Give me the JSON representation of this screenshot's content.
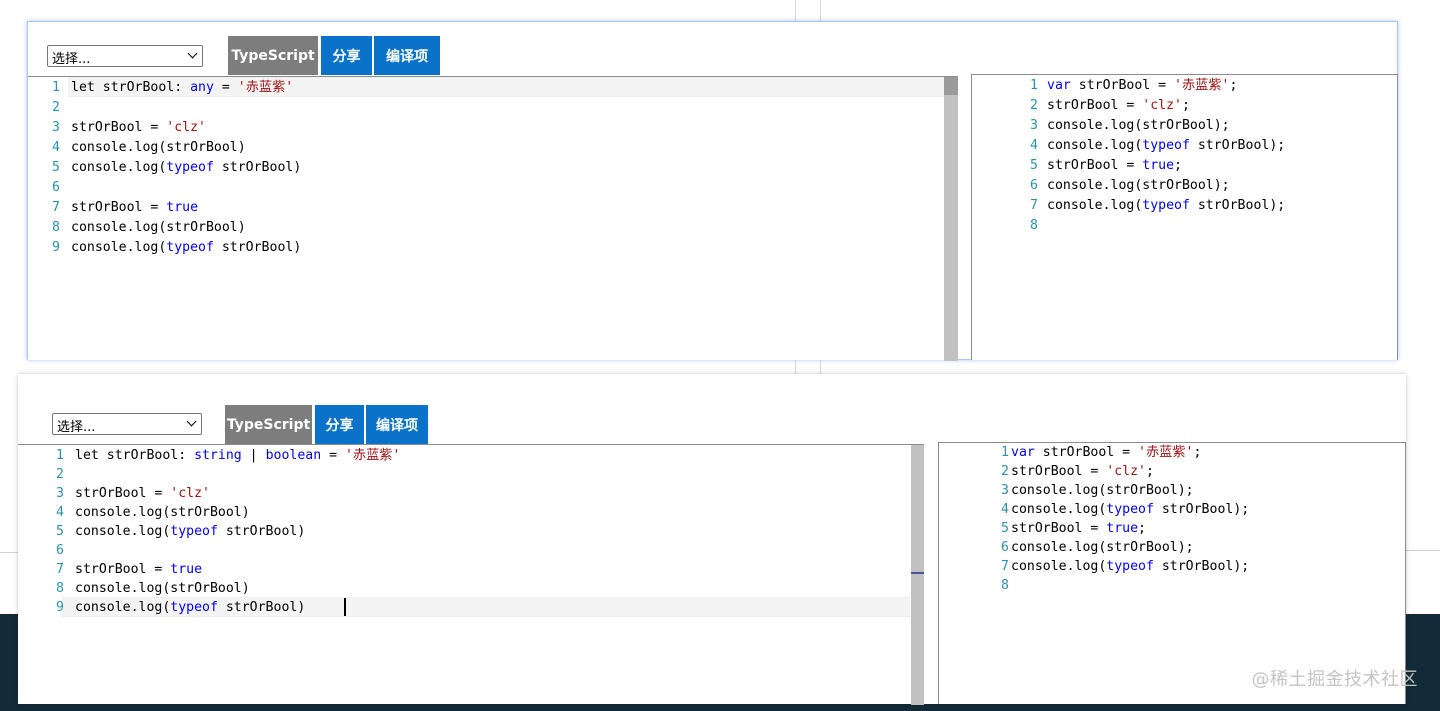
{
  "select_placeholder": "选择...",
  "buttons": {
    "typescript": "TypeScript",
    "share": "分享",
    "options": "编译项"
  },
  "watermark": "@稀土掘金技术社区",
  "colors": {
    "button_gray": "#7d7d7d",
    "button_blue": "#0a73c9",
    "keyword": "#0000ff",
    "string": "#a31515",
    "line_number": "#2b91af"
  },
  "top": {
    "input": [
      {
        "n": "1",
        "t": [
          {
            "c": "let strOrBool: "
          },
          {
            "c": "any",
            "k": "kw"
          },
          {
            "c": " = "
          },
          {
            "c": "'赤蓝紫'",
            "k": "str"
          }
        ]
      },
      {
        "n": "2",
        "t": []
      },
      {
        "n": "3",
        "t": [
          {
            "c": "strOrBool = "
          },
          {
            "c": "'clz'",
            "k": "str"
          }
        ]
      },
      {
        "n": "4",
        "t": [
          {
            "c": "console.log(strOrBool)"
          }
        ]
      },
      {
        "n": "5",
        "t": [
          {
            "c": "console.log("
          },
          {
            "c": "typeof",
            "k": "kw"
          },
          {
            "c": " strOrBool)"
          }
        ]
      },
      {
        "n": "6",
        "t": []
      },
      {
        "n": "7",
        "t": [
          {
            "c": "strOrBool = "
          },
          {
            "c": "true",
            "k": "kw"
          }
        ]
      },
      {
        "n": "8",
        "t": [
          {
            "c": "console.log(strOrBool)"
          }
        ]
      },
      {
        "n": "9",
        "t": [
          {
            "c": "console.log("
          },
          {
            "c": "typeof",
            "k": "kw"
          },
          {
            "c": " strOrBool)"
          }
        ]
      }
    ],
    "output": [
      {
        "n": "1",
        "t": [
          {
            "c": "var",
            "k": "kw"
          },
          {
            "c": " strOrBool = "
          },
          {
            "c": "'赤蓝紫'",
            "k": "str"
          },
          {
            "c": ";"
          }
        ]
      },
      {
        "n": "2",
        "t": [
          {
            "c": "strOrBool = "
          },
          {
            "c": "'clz'",
            "k": "str"
          },
          {
            "c": ";"
          }
        ]
      },
      {
        "n": "3",
        "t": [
          {
            "c": "console.log(strOrBool);"
          }
        ]
      },
      {
        "n": "4",
        "t": [
          {
            "c": "console.log("
          },
          {
            "c": "typeof",
            "k": "kw"
          },
          {
            "c": " strOrBool);"
          }
        ]
      },
      {
        "n": "5",
        "t": [
          {
            "c": "strOrBool = "
          },
          {
            "c": "true",
            "k": "kw"
          },
          {
            "c": ";"
          }
        ]
      },
      {
        "n": "6",
        "t": [
          {
            "c": "console.log(strOrBool);"
          }
        ]
      },
      {
        "n": "7",
        "t": [
          {
            "c": "console.log("
          },
          {
            "c": "typeof",
            "k": "kw"
          },
          {
            "c": " strOrBool);"
          }
        ]
      },
      {
        "n": "8",
        "t": []
      }
    ]
  },
  "bottom": {
    "input": [
      {
        "n": "1",
        "t": [
          {
            "c": "let strOrBool: "
          },
          {
            "c": "string",
            "k": "kw"
          },
          {
            "c": " | "
          },
          {
            "c": "boolean",
            "k": "kw"
          },
          {
            "c": " = "
          },
          {
            "c": "'赤蓝紫'",
            "k": "str"
          }
        ]
      },
      {
        "n": "2",
        "t": []
      },
      {
        "n": "3",
        "t": [
          {
            "c": "strOrBool = "
          },
          {
            "c": "'clz'",
            "k": "str"
          }
        ]
      },
      {
        "n": "4",
        "t": [
          {
            "c": "console.log(strOrBool)"
          }
        ]
      },
      {
        "n": "5",
        "t": [
          {
            "c": "console.log("
          },
          {
            "c": "typeof",
            "k": "kw"
          },
          {
            "c": " strOrBool)"
          }
        ]
      },
      {
        "n": "6",
        "t": []
      },
      {
        "n": "7",
        "t": [
          {
            "c": "strOrBool = "
          },
          {
            "c": "true",
            "k": "kw"
          }
        ]
      },
      {
        "n": "8",
        "t": [
          {
            "c": "console.log(strOrBool)"
          }
        ]
      },
      {
        "n": "9",
        "t": [
          {
            "c": "console.log("
          },
          {
            "c": "typeof",
            "k": "kw"
          },
          {
            "c": " strOrBool)"
          }
        ]
      }
    ],
    "output": [
      {
        "n": "1",
        "t": [
          {
            "c": "var",
            "k": "kw"
          },
          {
            "c": " strOrBool = "
          },
          {
            "c": "'赤蓝紫'",
            "k": "str"
          },
          {
            "c": ";"
          }
        ]
      },
      {
        "n": "2",
        "t": [
          {
            "c": "strOrBool = "
          },
          {
            "c": "'clz'",
            "k": "str"
          },
          {
            "c": ";"
          }
        ]
      },
      {
        "n": "3",
        "t": [
          {
            "c": "console.log(strOrBool);"
          }
        ]
      },
      {
        "n": "4",
        "t": [
          {
            "c": "console.log("
          },
          {
            "c": "typeof",
            "k": "kw"
          },
          {
            "c": " strOrBool);"
          }
        ]
      },
      {
        "n": "5",
        "t": [
          {
            "c": "strOrBool = "
          },
          {
            "c": "true",
            "k": "kw"
          },
          {
            "c": ";"
          }
        ]
      },
      {
        "n": "6",
        "t": [
          {
            "c": "console.log(strOrBool);"
          }
        ]
      },
      {
        "n": "7",
        "t": [
          {
            "c": "console.log("
          },
          {
            "c": "typeof",
            "k": "kw"
          },
          {
            "c": " strOrBool);"
          }
        ]
      },
      {
        "n": "8",
        "t": []
      }
    ]
  }
}
